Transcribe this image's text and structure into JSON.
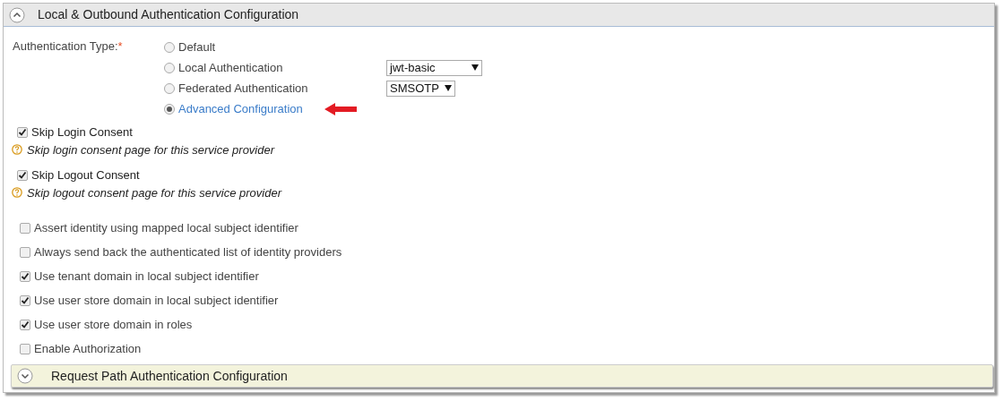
{
  "section": {
    "title": "Local & Outbound Authentication Configuration",
    "expanded": true
  },
  "auth_type": {
    "label": "Authentication Type:",
    "required_mark": "*",
    "options": [
      {
        "label": "Default",
        "selected": false
      },
      {
        "label": "Local Authentication",
        "selected": false,
        "select_value": "jwt-basic"
      },
      {
        "label": "Federated Authentication",
        "selected": false,
        "select_value": "SMSOTP"
      },
      {
        "label": "Advanced Configuration",
        "selected": true,
        "arrow": true
      }
    ]
  },
  "consents": [
    {
      "label": "Skip Login Consent",
      "checked": true,
      "help": "Skip login consent page for this service provider"
    },
    {
      "label": "Skip Logout Consent",
      "checked": true,
      "help": "Skip logout consent page for this service provider"
    }
  ],
  "options": [
    {
      "label": "Assert identity using mapped local subject identifier",
      "checked": false
    },
    {
      "label": "Always send back the authenticated list of identity providers",
      "checked": false
    },
    {
      "label": "Use tenant domain in local subject identifier",
      "checked": true
    },
    {
      "label": "Use user store domain in local subject identifier",
      "checked": true
    },
    {
      "label": "Use user store domain in roles",
      "checked": true
    },
    {
      "label": "Enable Authorization",
      "checked": false
    }
  ],
  "next_section": {
    "title": "Request Path Authentication Configuration",
    "expanded": false
  }
}
